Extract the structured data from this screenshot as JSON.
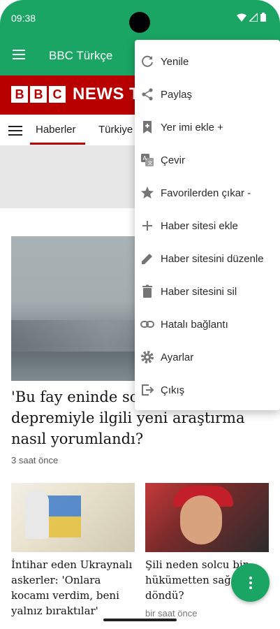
{
  "status_bar": {
    "time": "09:38"
  },
  "app_bar": {
    "title": "BBC Türkçe"
  },
  "brand": {
    "logo_letters": [
      "B",
      "B",
      "C"
    ],
    "news_text": "NEWS T"
  },
  "nav": {
    "tabs": [
      "Haberler",
      "Türkiye"
    ]
  },
  "articles": {
    "main": {
      "headline": "'Bu fay eninde so İstanbul depremiyle ilgili yeni araştırma nasıl yorumlandı?",
      "time": "3 saat önce"
    },
    "left": {
      "caption": "İntihar eden Ukraynalı askerler: 'Onlara kocamı verdim, beni yalnız bıraktılar'"
    },
    "right": {
      "caption": "Şili neden solcu bir hükümetten sağ döndü?",
      "time": "bir saat önce"
    }
  },
  "menu": {
    "items": [
      {
        "label": "Yenile",
        "icon": "refresh-icon"
      },
      {
        "label": "Paylaş",
        "icon": "share-icon"
      },
      {
        "label": "Yer imi ekle +",
        "icon": "bookmark-add-icon"
      },
      {
        "label": "Çevir",
        "icon": "translate-icon"
      },
      {
        "label": "Favorilerden çıkar -",
        "icon": "star-icon"
      },
      {
        "label": "Haber sitesi ekle",
        "icon": "plus-icon"
      },
      {
        "label": "Haber sitesini düzenle",
        "icon": "pencil-icon"
      },
      {
        "label": "Haber sitesini sil",
        "icon": "trash-icon"
      },
      {
        "label": "Hatalı bağlantı",
        "icon": "link-icon"
      },
      {
        "label": "Ayarlar",
        "icon": "gear-icon"
      },
      {
        "label": "Çıkış",
        "icon": "exit-icon"
      }
    ]
  },
  "colors": {
    "primary": "#1aa564",
    "bbc_red": "#b80000",
    "menu_icon": "#757575"
  }
}
